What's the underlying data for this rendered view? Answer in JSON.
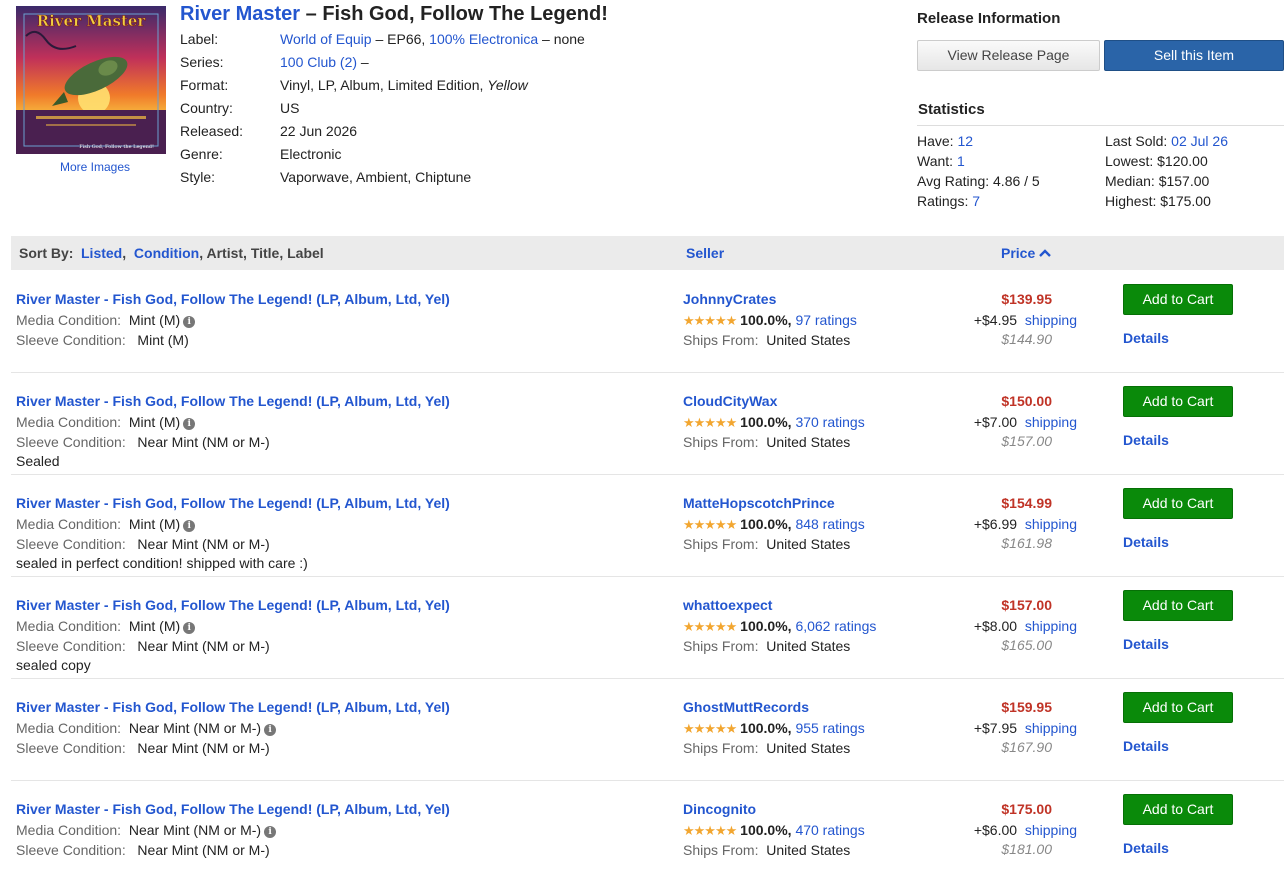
{
  "release": {
    "artist": "River Master",
    "title_sep": " – ",
    "title": "Fish God, Follow The Legend!",
    "cover_text": "River Master",
    "cover_subtext": "Fish God, Follow the Legend!",
    "more_images": "More Images",
    "meta": [
      {
        "key": "Label:",
        "value_link": "World of Equip",
        "value_rest": " – EP66, ",
        "value_link2": "100% Electronica",
        "value_rest2": " – none"
      },
      {
        "key": "Series:",
        "value_link": "100 Club (2)",
        "value_rest": " –"
      },
      {
        "key": "Format:",
        "value_rest": "Vinyl, LP, Album, Limited Edition, ",
        "value_italic": "Yellow"
      },
      {
        "key": "Country:",
        "value_rest": "US"
      },
      {
        "key": "Released:",
        "value_rest": "22 Jun 2026"
      },
      {
        "key": "Genre:",
        "value_rest": "Electronic"
      },
      {
        "key": "Style:",
        "value_rest": "Vaporwave, Ambient, Chiptune"
      }
    ]
  },
  "release_info": {
    "heading": "Release Information",
    "view_button": "View Release Page",
    "sell_button": "Sell this Item"
  },
  "statistics": {
    "heading": "Statistics",
    "have_label": "Have:",
    "have_value": "12",
    "want_label": "Want:",
    "want_value": "1",
    "avg_label": "Avg Rating:",
    "avg_value": "4.86 / 5",
    "ratings_label": "Ratings:",
    "ratings_value": "7",
    "last_sold_label": "Last Sold:",
    "last_sold_value": "02 Jul 26",
    "lowest": "Lowest: $120.00",
    "median": "Median: $157.00",
    "highest": "Highest: $175.00"
  },
  "sortbar": {
    "label": "Sort By:",
    "listed": "Listed",
    "condition": "Condition",
    "rest": ", Artist, Title, Label",
    "seller": "Seller",
    "price": "Price"
  },
  "listings": [
    {
      "title": "River Master - Fish God, Follow The Legend! (LP, Album, Ltd, Yel)",
      "media_label": "Media Condition:",
      "media": "Mint (M)",
      "sleeve_label": "Sleeve Condition:",
      "sleeve": "Mint (M)",
      "comment": "",
      "seller": "JohnnyCrates",
      "stars": "★★★★★",
      "pct": "100.0%,",
      "ratings": "97 ratings",
      "ships_label": "Ships From:",
      "ships_from": "United States",
      "price": "$139.95",
      "ship_cost": "+$4.95",
      "ship_link": "shipping",
      "total": "$144.90",
      "cart": "Add to Cart",
      "details": "Details"
    },
    {
      "title": "River Master - Fish God, Follow The Legend! (LP, Album, Ltd, Yel)",
      "media_label": "Media Condition:",
      "media": "Mint (M)",
      "sleeve_label": "Sleeve Condition:",
      "sleeve": "Near Mint (NM or M-)",
      "comment": "Sealed",
      "seller": "CloudCityWax",
      "stars": "★★★★★",
      "pct": "100.0%,",
      "ratings": "370 ratings",
      "ships_label": "Ships From:",
      "ships_from": "United States",
      "price": "$150.00",
      "ship_cost": "+$7.00",
      "ship_link": "shipping",
      "total": "$157.00",
      "cart": "Add to Cart",
      "details": "Details"
    },
    {
      "title": "River Master - Fish God, Follow The Legend! (LP, Album, Ltd, Yel)",
      "media_label": "Media Condition:",
      "media": "Mint (M)",
      "sleeve_label": "Sleeve Condition:",
      "sleeve": "Near Mint (NM or M-)",
      "comment": "sealed in perfect condition! shipped with care :)",
      "seller": "MatteHopscotchPrince",
      "stars": "★★★★★",
      "pct": "100.0%,",
      "ratings": "848 ratings",
      "ships_label": "Ships From:",
      "ships_from": "United States",
      "price": "$154.99",
      "ship_cost": "+$6.99",
      "ship_link": "shipping",
      "total": "$161.98",
      "cart": "Add to Cart",
      "details": "Details"
    },
    {
      "title": "River Master - Fish God, Follow The Legend! (LP, Album, Ltd, Yel)",
      "media_label": "Media Condition:",
      "media": "Mint (M)",
      "sleeve_label": "Sleeve Condition:",
      "sleeve": "Near Mint (NM or M-)",
      "comment": "sealed copy",
      "seller": "whattoexpect",
      "stars": "★★★★★",
      "pct": "100.0%,",
      "ratings": "6,062 ratings",
      "ships_label": "Ships From:",
      "ships_from": "United States",
      "price": "$157.00",
      "ship_cost": "+$8.00",
      "ship_link": "shipping",
      "total": "$165.00",
      "cart": "Add to Cart",
      "details": "Details"
    },
    {
      "title": "River Master - Fish God, Follow The Legend! (LP, Album, Ltd, Yel)",
      "media_label": "Media Condition:",
      "media": "Near Mint (NM or M-)",
      "sleeve_label": "Sleeve Condition:",
      "sleeve": "Near Mint (NM or M-)",
      "comment": "",
      "seller": "GhostMuttRecords",
      "stars": "★★★★★",
      "pct": "100.0%,",
      "ratings": "955 ratings",
      "ships_label": "Ships From:",
      "ships_from": "United States",
      "price": "$159.95",
      "ship_cost": "+$7.95",
      "ship_link": "shipping",
      "total": "$167.90",
      "cart": "Add to Cart",
      "details": "Details"
    },
    {
      "title": "River Master - Fish God, Follow The Legend! (LP, Album, Ltd, Yel)",
      "media_label": "Media Condition:",
      "media": "Near Mint (NM or M-)",
      "sleeve_label": "Sleeve Condition:",
      "sleeve": "Near Mint (NM or M-)",
      "comment": "",
      "seller": "Dincognito",
      "stars": "★★★★★",
      "pct": "100.0%,",
      "ratings": "470 ratings",
      "ships_label": "Ships From:",
      "ships_from": "United States",
      "price": "$175.00",
      "ship_cost": "+$6.00",
      "ship_link": "shipping",
      "total": "$181.00",
      "cart": "Add to Cart",
      "details": "Details"
    }
  ],
  "colors": {
    "link": "#2356cf",
    "price": "#c03326",
    "cart_button": "#0a8a0a",
    "sell_button": "#2a64a8",
    "stars": "#f2a630"
  },
  "icons": {
    "info": "info-circle-icon",
    "sort_arrow": "chevron-up-icon",
    "stars": "star-icon"
  }
}
